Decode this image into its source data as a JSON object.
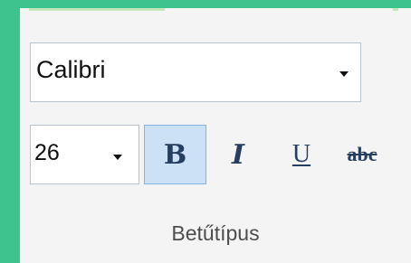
{
  "ribbon_group": {
    "font_name": {
      "value": "Calibri"
    },
    "font_size": {
      "value": "26"
    },
    "bold": {
      "label": "B",
      "active": true
    },
    "italic": {
      "label": "I"
    },
    "underline": {
      "label": "U"
    },
    "strikethrough": {
      "label": "abc"
    },
    "label": "Betűtípus"
  },
  "colors": {
    "background": "#3ec28e",
    "panel": "#f4f4f4",
    "active_button": "#cce1f5",
    "active_border": "#86b4e0",
    "accent": "#c4e8bc"
  },
  "icons": {
    "dropdown": "chevron-down-icon"
  }
}
